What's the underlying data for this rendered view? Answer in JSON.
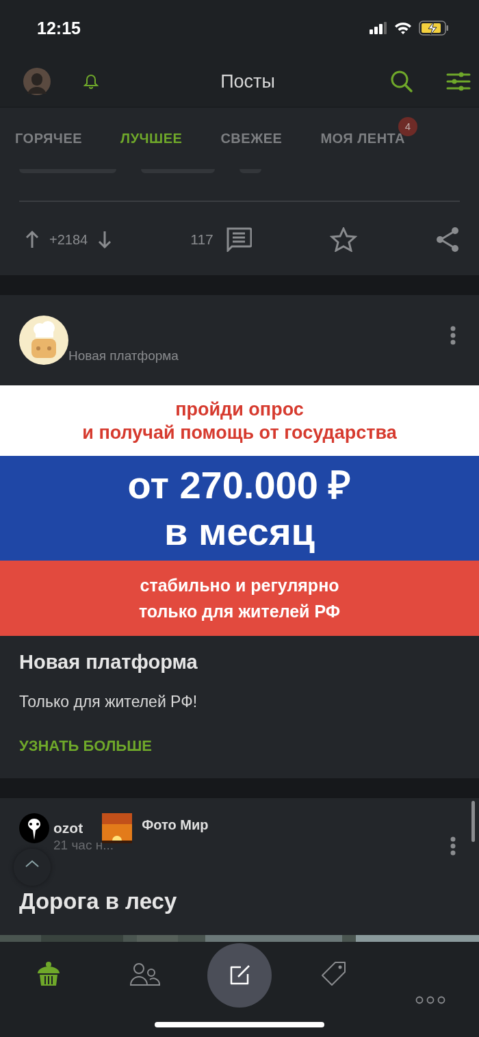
{
  "status_bar": {
    "time": "12:15"
  },
  "header": {
    "title": "Посты"
  },
  "tabs": [
    {
      "label": "ГОРЯЧЕЕ",
      "selected": false
    },
    {
      "label": "ЛУЧШЕЕ",
      "selected": true
    },
    {
      "label": "СВЕЖЕЕ",
      "selected": false
    },
    {
      "label": "МОЯ ЛЕНТА",
      "selected": false,
      "badge": "4"
    }
  ],
  "previous_post": {
    "rating": "+2184",
    "comments": "117"
  },
  "ad_post": {
    "author": "Новая платформа",
    "banner": {
      "top_lines": [
        "пройди опрос",
        "и получай помощь от государства"
      ],
      "middle_lines": [
        "от 270.000 ₽",
        "в месяц"
      ],
      "bottom_lines": [
        "стабильно и регулярно",
        "только для жителей РФ"
      ]
    },
    "title": "Новая платформа",
    "text": "Только для жителей РФ!",
    "link": "УЗНАТЬ БОЛЬШЕ"
  },
  "post": {
    "author": "ozot",
    "community": "Фото Мир",
    "time": "21 час н...",
    "title": "Дорога в лесу"
  },
  "bottom_nav": [
    {
      "kind": "home",
      "selected": true
    },
    {
      "kind": "community",
      "selected": false
    },
    {
      "kind": "compose",
      "selected": false
    },
    {
      "kind": "tags",
      "selected": false
    },
    {
      "kind": "more",
      "selected": false
    }
  ]
}
